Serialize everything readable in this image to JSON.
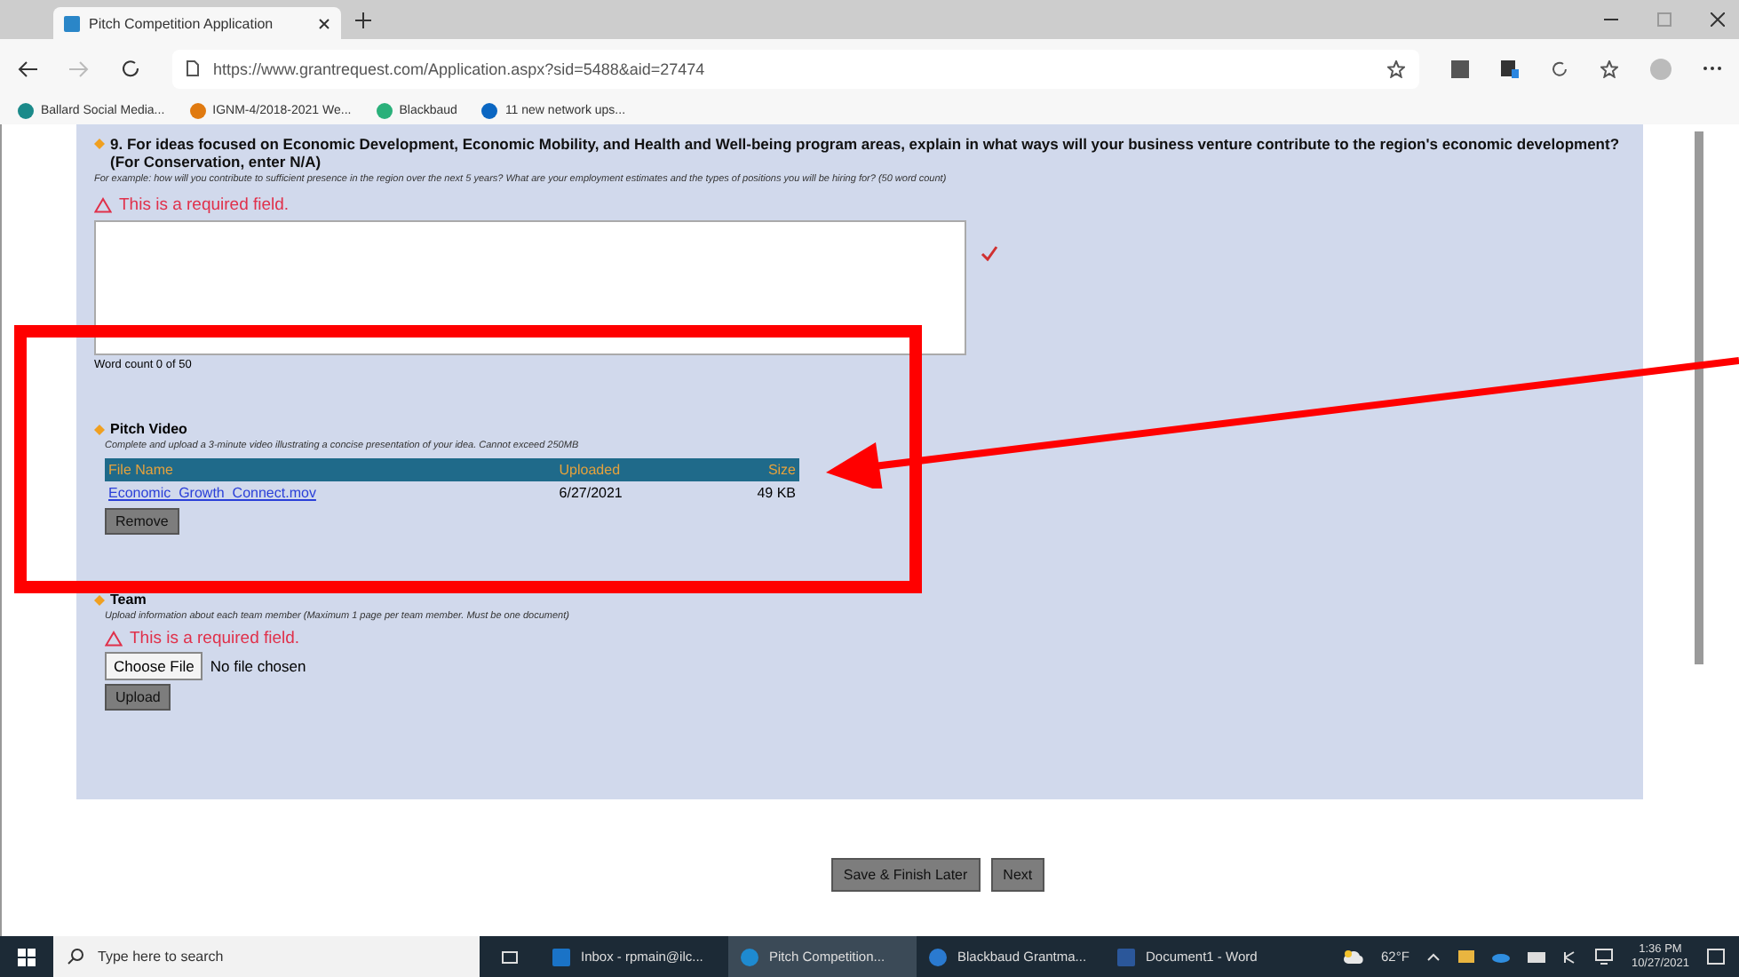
{
  "browser": {
    "tab_title": "Pitch Competition Application",
    "url": "https://www.grantrequest.com/Application.aspx?sid=5488&aid=27474",
    "bookmarks": [
      "Ballard Social Media...",
      "IGNM-4/2018-2021 We...",
      "Blackbaud",
      "11 new network ups..."
    ]
  },
  "question": {
    "title": "9. For ideas focused on Economic Development, Economic Mobility, and Health and Well-being program areas, explain in what ways will your business venture contribute to the region's economic development?",
    "subtitle": "(For Conservation, enter N/A)",
    "hint": "For example: how will you contribute to sufficient presence in the region over the next 5 years? What are your employment estimates and the types of positions you will be hiring for? (50 word count)",
    "error": "This is a required field.",
    "valid": true,
    "word_count": "Word count 0 of 50"
  },
  "pitch_video": {
    "title": "Pitch Video",
    "hint": "Complete and upload a 3-minute video illustrating a concise presentation of your idea. Cannot exceed 250MB",
    "columns": [
      "File Name",
      "Uploaded",
      "Size"
    ],
    "rows": [
      {
        "file": "Economic_Growth_Connect.mov",
        "uploaded": "6/27/2021",
        "size": "49 KB"
      }
    ],
    "remove": "Remove"
  },
  "team": {
    "title": "Team",
    "hint": "Upload information about each team member (Maximum 1 page per team member. Must be one document)",
    "error": "This is a required field.",
    "choose": "Choose File",
    "no_file": "No file chosen",
    "upload": "Upload"
  },
  "buttons": [
    "Save & Finish Later",
    "Next"
  ],
  "taskbar": {
    "search_placeholder": "Type here to search",
    "apps": [
      {
        "label": "Inbox - rpmain@ilc...",
        "kind": "mail",
        "selected": false
      },
      {
        "label": "Pitch Competition...",
        "kind": "edge",
        "selected": true
      },
      {
        "label": "Blackbaud Grantma...",
        "kind": "ie",
        "selected": false
      },
      {
        "label": "Document1 - Word",
        "kind": "word",
        "selected": false
      }
    ],
    "weather": "62°F",
    "time": "1:36 PM",
    "date": "10/27/2021"
  }
}
